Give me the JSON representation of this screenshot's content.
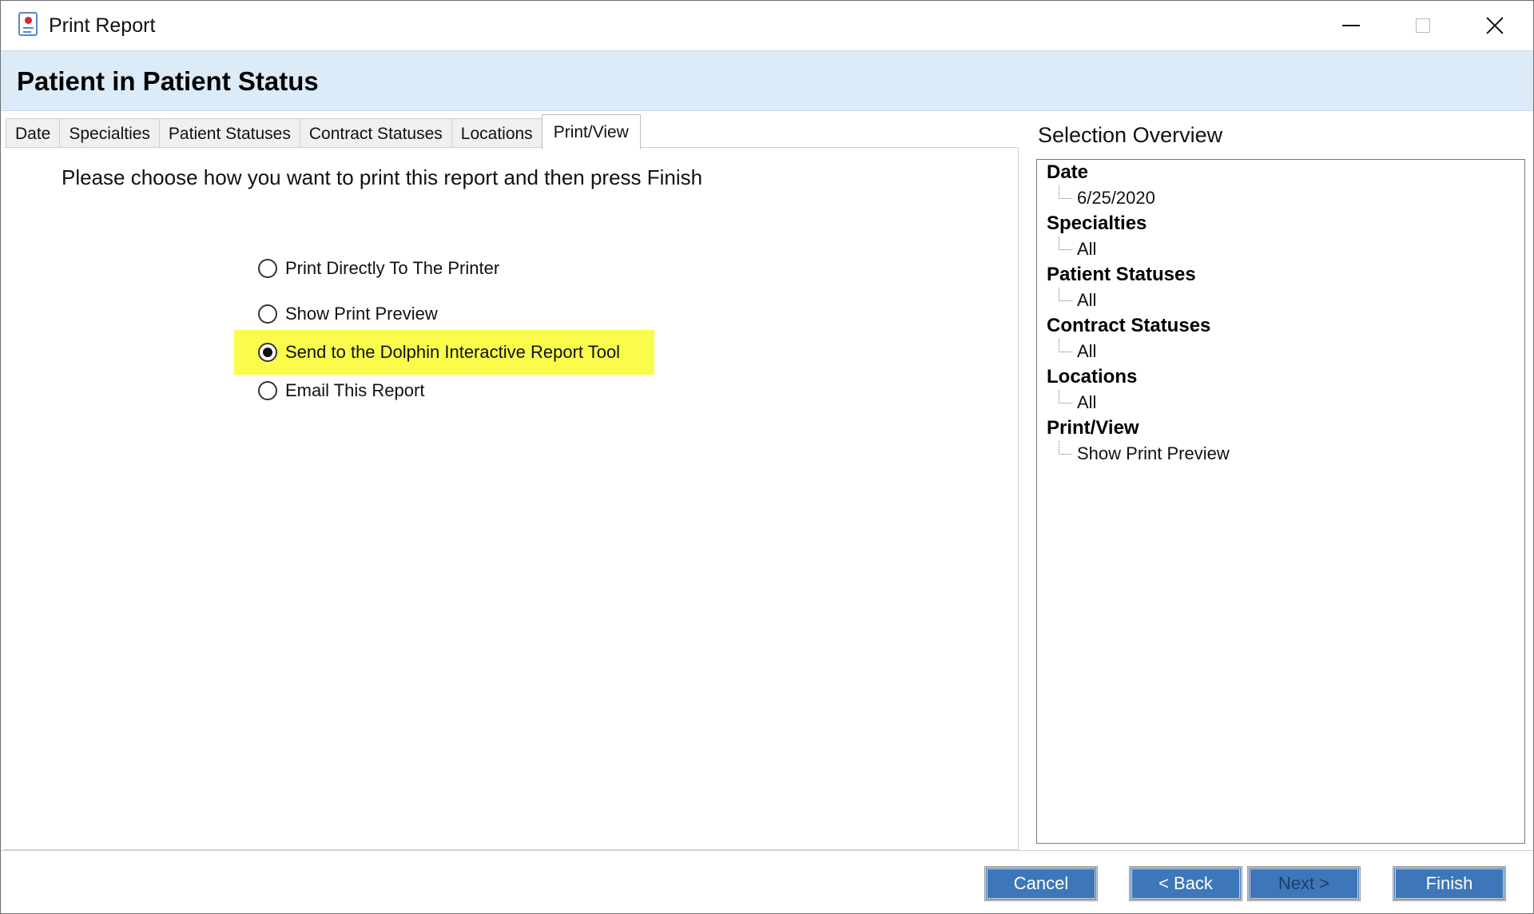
{
  "window": {
    "title": "Print Report",
    "icon": "report-icon"
  },
  "header": {
    "title": "Patient in Patient Status"
  },
  "tabs": [
    {
      "label": "Date"
    },
    {
      "label": "Specialties"
    },
    {
      "label": "Patient Statuses"
    },
    {
      "label": "Contract Statuses"
    },
    {
      "label": "Locations"
    },
    {
      "label": "Print/View",
      "active": true
    }
  ],
  "print_view": {
    "instruction": "Please choose how you want to print this report and then press Finish",
    "options": [
      {
        "label": "Print Directly To The Printer",
        "checked": false
      },
      {
        "label": "Show Print Preview",
        "checked": false
      },
      {
        "label": "Send to the Dolphin Interactive Report Tool",
        "checked": true,
        "highlighted": true
      },
      {
        "label": "Email This Report",
        "checked": false
      }
    ]
  },
  "overview": {
    "title": "Selection Overview",
    "groups": [
      {
        "heading": "Date",
        "value": "6/25/2020"
      },
      {
        "heading": "Specialties",
        "value": "All"
      },
      {
        "heading": "Patient Statuses",
        "value": "All"
      },
      {
        "heading": "Contract Statuses",
        "value": "All"
      },
      {
        "heading": "Locations",
        "value": "All"
      },
      {
        "heading": "Print/View",
        "value": "Show Print Preview"
      }
    ]
  },
  "footer": {
    "cancel": "Cancel",
    "back": "< Back",
    "next": "Next >",
    "finish": "Finish"
  },
  "colors": {
    "header_band": "#dcebf8",
    "highlight": "#fbfb4b",
    "button": "#3d77ba"
  }
}
